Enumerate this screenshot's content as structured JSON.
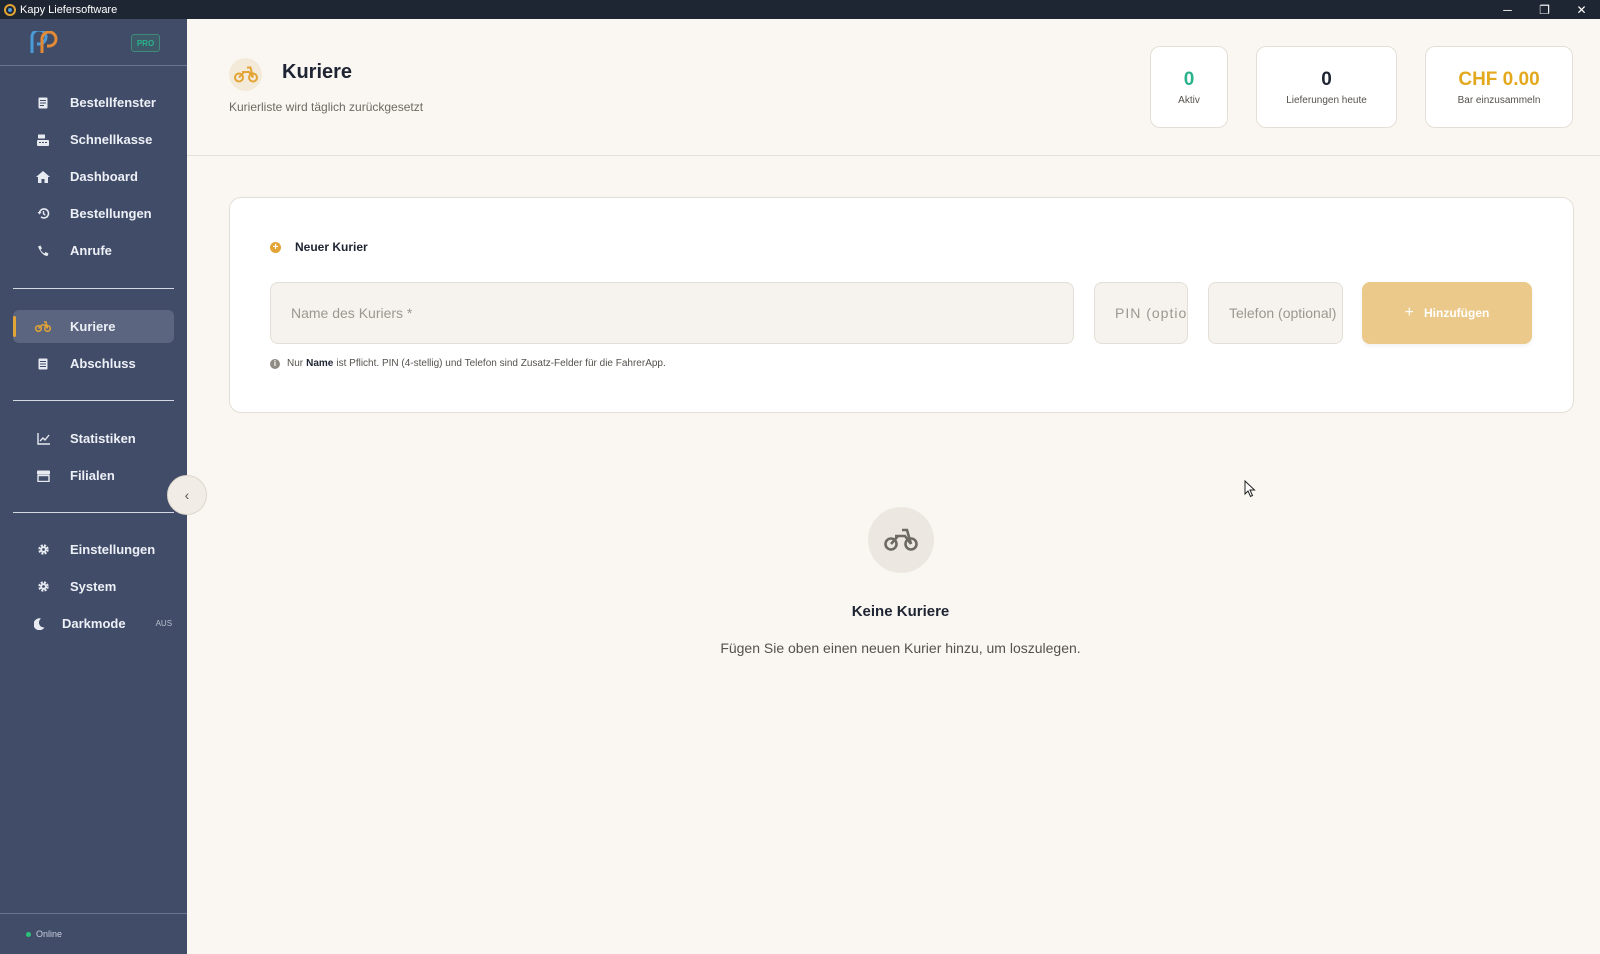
{
  "window": {
    "title": "Kapy Liefersoftware",
    "minimize": "─",
    "restore": "❐",
    "close": "✕"
  },
  "sidebar": {
    "badge": "PRO",
    "items": [
      {
        "label": "Bestellfenster",
        "icon": "receipt-icon"
      },
      {
        "label": "Schnellkasse",
        "icon": "cash-register-icon"
      },
      {
        "label": "Dashboard",
        "icon": "home-icon"
      },
      {
        "label": "Bestellungen",
        "icon": "history-icon"
      },
      {
        "label": "Anrufe",
        "icon": "phone-icon"
      },
      {
        "label": "Kuriere",
        "icon": "motorcycle-icon",
        "active": true
      },
      {
        "label": "Abschluss",
        "icon": "document-icon"
      },
      {
        "label": "Statistiken",
        "icon": "chart-line-icon"
      },
      {
        "label": "Filialen",
        "icon": "store-icon"
      },
      {
        "label": "Einstellungen",
        "icon": "gear-icon"
      },
      {
        "label": "System",
        "icon": "gear-icon"
      }
    ],
    "darkmode": {
      "label": "Darkmode",
      "state": "AUS"
    },
    "collapse": "‹",
    "status": "Online"
  },
  "header": {
    "title": "Kuriere",
    "subtitle": "Kurierliste wird täglich zurückgesetzt",
    "stats": [
      {
        "value": "0",
        "label": "Aktiv",
        "color": "#2bb28d"
      },
      {
        "value": "0",
        "label": "Lieferungen heute",
        "color": "#1f2433"
      },
      {
        "value": "CHF 0.00",
        "label": "Bar einzusammeln",
        "color": "#e3a91e"
      }
    ]
  },
  "form": {
    "title": "Neuer Kurier",
    "name_placeholder": "Name des Kuriers *",
    "pin_placeholder": "PIN (optional)",
    "phone_placeholder": "Telefon (optional)",
    "add_label": "Hinzufügen",
    "hint_prefix": "Nur",
    "hint_bold": "Name",
    "hint_suffix": "ist Pflicht. PIN (4-stellig) und Telefon sind Zusatz-Felder für die FahrerApp."
  },
  "empty": {
    "title": "Keine Kuriere",
    "subtitle": "Fügen Sie oben einen neuen Kurier hinzu, um loszulegen."
  },
  "colors": {
    "accent": "#e3a436",
    "sidebar": "#414c68",
    "background": "#faf7f2"
  }
}
